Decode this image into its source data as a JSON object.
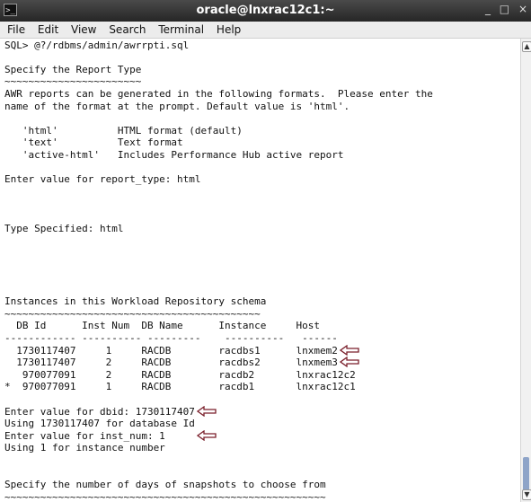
{
  "window": {
    "title": "oracle@lnxrac12c1:~",
    "icon": "terminal-icon",
    "controls": [
      "_",
      "□",
      "×"
    ]
  },
  "menu": [
    "File",
    "Edit",
    "View",
    "Search",
    "Terminal",
    "Help"
  ],
  "terminal_lines": [
    "SQL> @?/rdbms/admin/awrrpti.sql",
    "",
    "Specify the Report Type",
    "~~~~~~~~~~~~~~~~~~~~~~~",
    "AWR reports can be generated in the following formats.  Please enter the",
    "name of the format at the prompt. Default value is 'html'.",
    "",
    "   'html'          HTML format (default)",
    "   'text'          Text format",
    "   'active-html'   Includes Performance Hub active report",
    "",
    "Enter value for report_type: html",
    "",
    "",
    "",
    "Type Specified: html",
    "",
    "",
    "",
    "",
    "",
    "Instances in this Workload Repository schema",
    "~~~~~~~~~~~~~~~~~~~~~~~~~~~~~~~~~~~~~~~~~~~",
    "  DB Id      Inst Num  DB Name      Instance     Host",
    "------------ ---------- ---------    ----------   ------",
    "  1730117407     1     RACDB        racdbs1      lnxmem2",
    "  1730117407     2     RACDB        racdbs2      lnxmem3",
    "   970077091     2     RACDB        racdb2       lnxrac12c2",
    "*  970077091     1     RACDB        racdb1       lnxrac12c1",
    "",
    "Enter value for dbid: 1730117407",
    "Using 1730117407 for database Id",
    "Enter value for inst_num: 1",
    "Using 1 for instance number",
    "",
    "",
    "Specify the number of days of snapshots to choose from",
    "~~~~~~~~~~~~~~~~~~~~~~~~~~~~~~~~~~~~~~~~~~~~~~~~~~~~~~"
  ],
  "arrow_color": "#7a1f2b"
}
